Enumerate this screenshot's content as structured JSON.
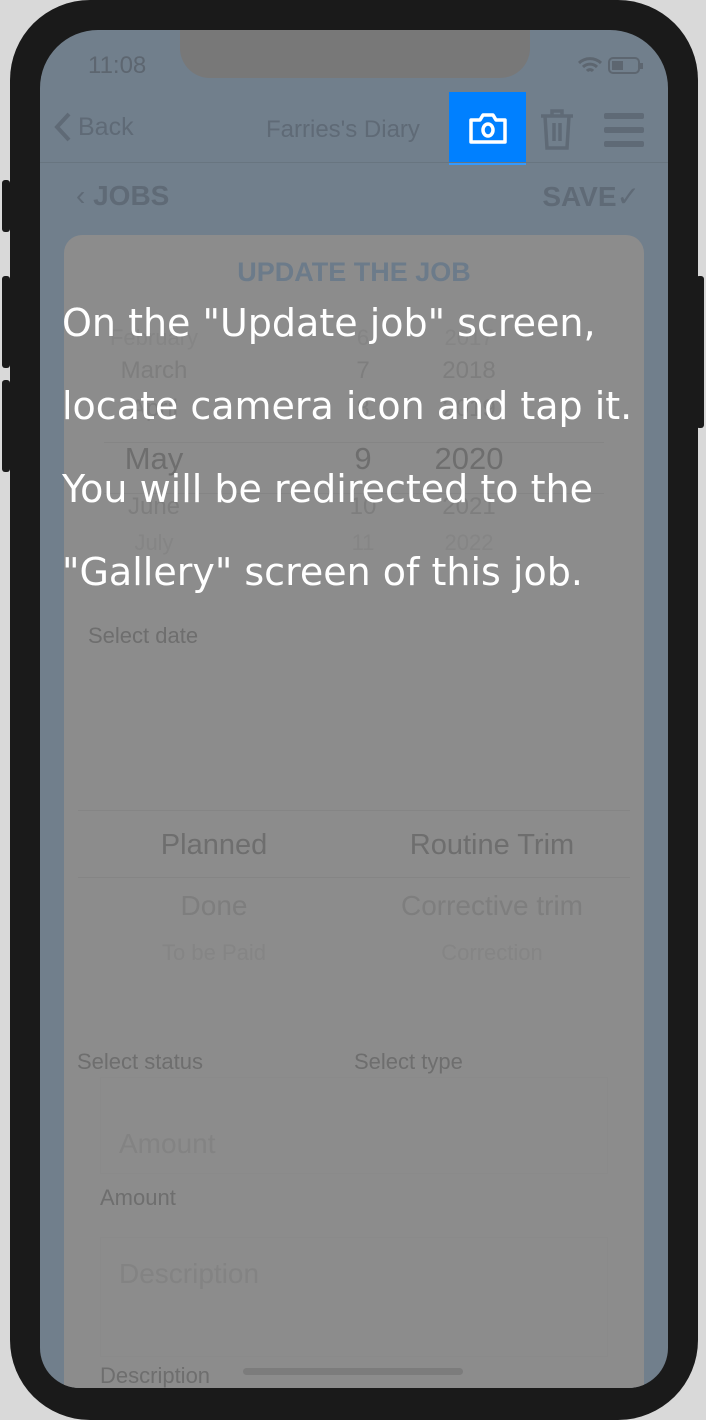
{
  "status_bar": {
    "time": "11:08",
    "wifi_icon": "wifi-icon",
    "battery_icon": "battery-icon"
  },
  "navbar": {
    "back_label": "Back",
    "title": "Farries's Diary",
    "camera_icon": "camera-icon",
    "trash_icon": "trash-icon",
    "menu_icon": "menu-icon",
    "highlight_color": "#0080ff"
  },
  "subbar": {
    "jobs_label": "JOBS",
    "save_label": "SAVE"
  },
  "card": {
    "title": "UPDATE THE JOB",
    "date_picker": {
      "months": [
        "February",
        "March",
        "April",
        "May",
        "June",
        "July"
      ],
      "days": [
        "6",
        "7",
        "8",
        "9",
        "10",
        "11"
      ],
      "years": [
        "2017",
        "2018",
        "2019",
        "2020",
        "2021",
        "2022"
      ],
      "selected": {
        "month": "May",
        "day": "9",
        "year": "2020"
      },
      "label": "Select date"
    },
    "status_picker": {
      "options": [
        "Planned",
        "Done",
        "To be Paid"
      ],
      "selected": "Planned",
      "label": "Select status"
    },
    "type_picker": {
      "options": [
        "Routine Trim",
        "Corrective trim",
        "Correction"
      ],
      "selected": "Routine Trim",
      "label": "Select type"
    },
    "amount": {
      "placeholder": "Amount",
      "label": "Amount"
    },
    "description": {
      "placeholder": "Description",
      "label": "Description"
    }
  },
  "tutorial": {
    "text": "On the \"Update job\" screen, locate camera icon and tap it. You will be redirected to the \"Gallery\" screen of this job."
  }
}
